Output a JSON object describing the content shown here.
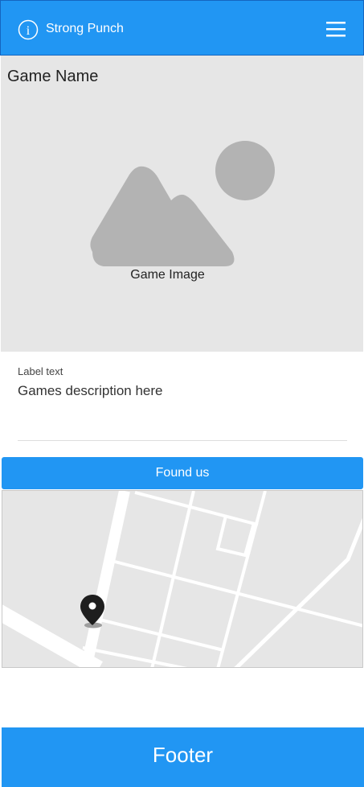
{
  "header": {
    "title": "Strong Punch",
    "info_icon": "info-icon",
    "menu_icon": "hamburger-menu-icon",
    "background": "#2196f3"
  },
  "game": {
    "name": "Game Name",
    "image_caption": "Game Image",
    "image_icon": "image-placeholder-icon"
  },
  "description": {
    "label": "Label text",
    "value": "Games description here"
  },
  "found_us": {
    "label": "Found us"
  },
  "map": {
    "marker_icon": "map-pin-icon"
  },
  "footer": {
    "label": "Footer"
  }
}
